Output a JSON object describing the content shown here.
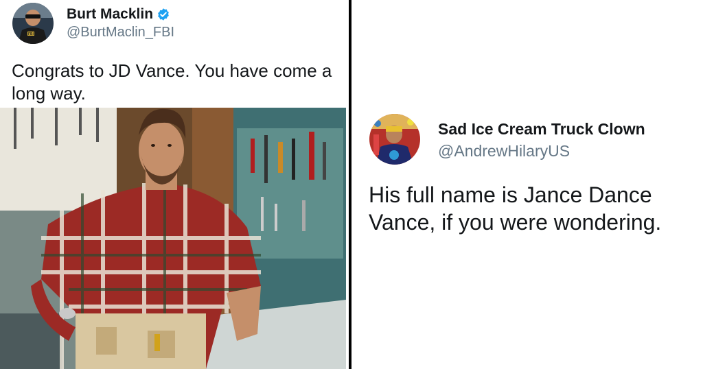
{
  "left_tweet": {
    "display_name": "Burt Macklin",
    "handle": "@BurtMaclin_FBI",
    "text": "Congrats to JD Vance. You have come a long way.",
    "verified_icon": "verified-badge-icon",
    "avatar_badge": "FBI"
  },
  "right_tweet": {
    "display_name": "Sad Ice Cream Truck Clown",
    "handle": "@AndrewHilaryUS",
    "text": "His full name is Jance Dance Vance, if you were wondering."
  },
  "colors": {
    "verified_blue": "#1da1f2",
    "handle_gray": "#657786",
    "text": "#14171a",
    "divider": "#000000"
  }
}
